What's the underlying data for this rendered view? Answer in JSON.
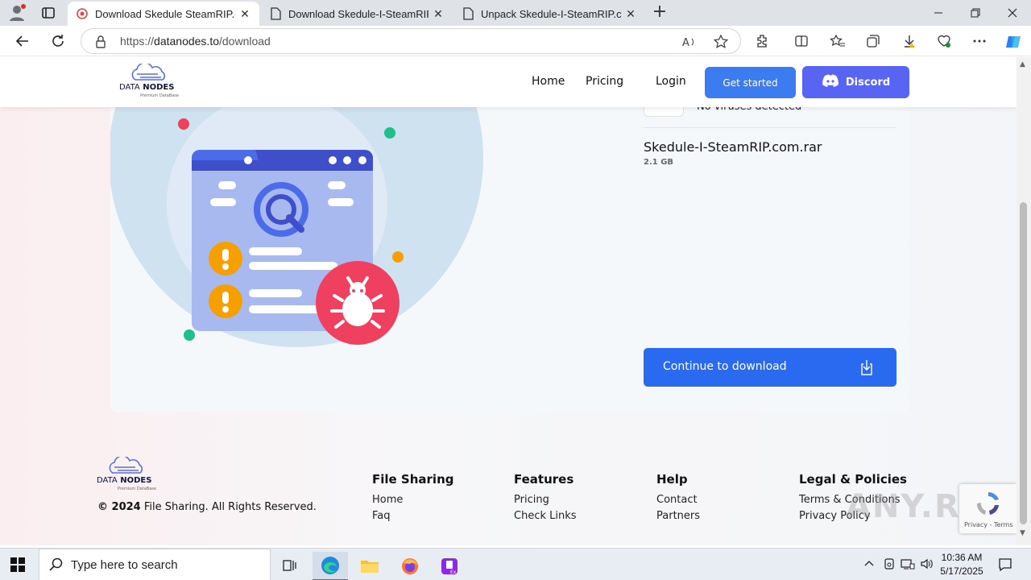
{
  "browser": {
    "tabs": [
      {
        "label": "Download Skedule SteamRIP.com",
        "active": true
      },
      {
        "label": "Download Skedule-I-SteamRIP.com",
        "active": false
      },
      {
        "label": "Unpack Skedule-I-SteamRIP.com",
        "active": false
      }
    ],
    "close_glyph": "✕",
    "new_tab_glyph": "+",
    "url_scheme": "https://",
    "url_host": "datanodes.to",
    "url_path": "/download"
  },
  "site": {
    "logo_bold_1": "DATA",
    "logo_bold_2": "NODES",
    "logo_sub": "Premium DataBase",
    "nav": {
      "home": "Home",
      "pricing": "Pricing",
      "login": "Login",
      "get_started": "Get started",
      "discord": "Discord"
    },
    "scan_result": "No viruses detected",
    "file_name": "Skedule-I-SteamRIP.com.rar",
    "file_size": "2.1 GB",
    "continue_button": "Continue to download",
    "colors": {
      "primary": "#2a6af0",
      "discord": "#5865f2",
      "danger": "#f04060",
      "warning": "#f5a000",
      "accent_green": "#1dbf8a"
    }
  },
  "footer": {
    "copyright_year": "© 2024",
    "copyright_text": " File Sharing. All Rights Reserved.",
    "columns": [
      {
        "title": "File Sharing",
        "links": [
          "Home",
          "Faq"
        ]
      },
      {
        "title": "Features",
        "links": [
          "Pricing",
          "Check Links"
        ]
      },
      {
        "title": "Help",
        "links": [
          "Contact",
          "Partners"
        ]
      },
      {
        "title": "Legal & Policies",
        "links": [
          "Terms & Conditions",
          "Privacy Policy"
        ]
      }
    ]
  },
  "recaptcha": {
    "text": "Privacy - Terms"
  },
  "watermark": "ANY.RUN",
  "taskbar": {
    "search_placeholder": "Type here to search",
    "time": "10:36 AM",
    "date": "5/17/2025"
  }
}
